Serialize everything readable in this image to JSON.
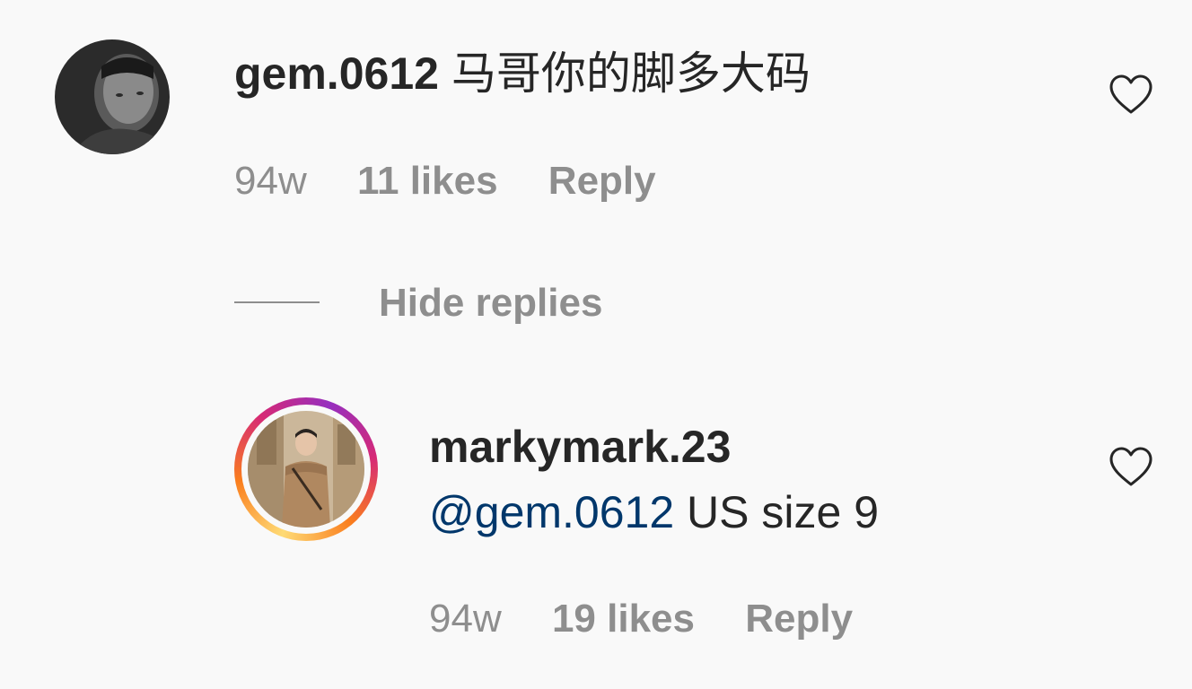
{
  "comment": {
    "username": "gem.0612",
    "text": "马哥你的脚多大码",
    "time": "94w",
    "likes": "11 likes",
    "reply_label": "Reply",
    "avatar_icon": "user-avatar-photo-icon",
    "like_icon": "heart-outline-icon"
  },
  "thread": {
    "hide_replies_label": "Hide replies"
  },
  "reply": {
    "username": "markymark.23",
    "mention": "@gem.0612",
    "text": " US size 9",
    "time": "94w",
    "likes": "19 likes",
    "reply_label": "Reply",
    "avatar_icon": "user-avatar-photo-icon",
    "like_icon": "heart-outline-icon",
    "story_ring_colors": [
      "#feda75",
      "#fa7e1e",
      "#d62976",
      "#962fbf"
    ]
  },
  "colors": {
    "text_primary": "#262626",
    "text_secondary": "#8e8e8e",
    "mention": "#00376b",
    "background": "#f9f9f9"
  }
}
